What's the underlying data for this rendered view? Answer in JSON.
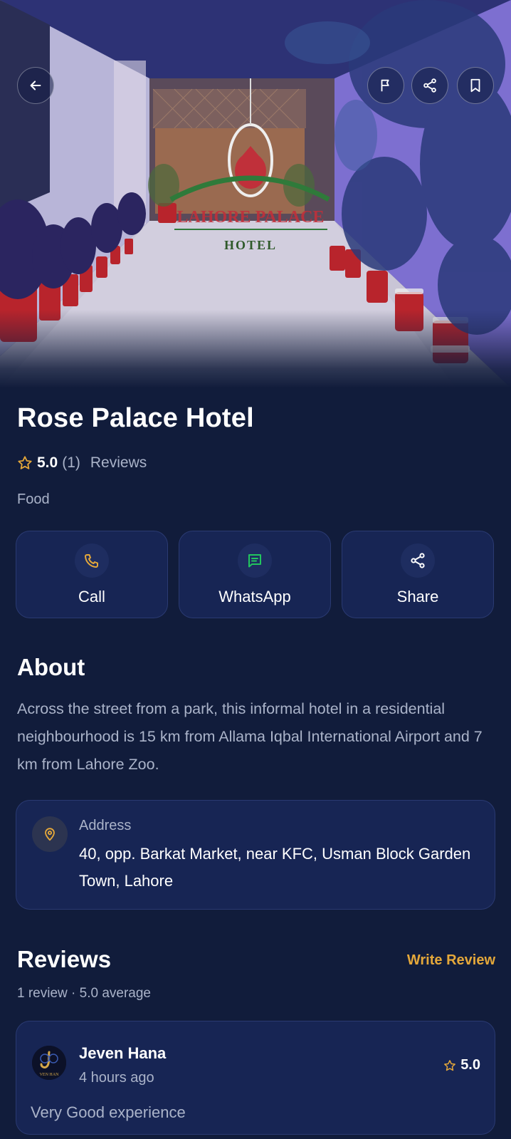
{
  "hero": {
    "sign_line1": "LAHORE PALACE",
    "sign_line2": "HOTEL"
  },
  "top_actions": {
    "back": "arrow-left-icon",
    "flag": "flag-icon",
    "share": "share-icon",
    "bookmark": "bookmark-icon"
  },
  "place": {
    "name": "Rose Palace Hotel",
    "rating": "5.0",
    "rating_count": "(1)",
    "reviews_label": "Reviews",
    "category": "Food"
  },
  "actions": [
    {
      "label": "Call",
      "icon": "phone-icon",
      "color": "#e5a83a"
    },
    {
      "label": "WhatsApp",
      "icon": "message-icon",
      "color": "#22c55e"
    },
    {
      "label": "Share",
      "icon": "share-icon",
      "color": "#ffffff"
    }
  ],
  "about": {
    "title": "About",
    "text": "Across the street from a park, this informal hotel in a residential neighbourhood is 15 km from Allama Iqbal International Airport and 7 km from Lahore Zoo."
  },
  "address": {
    "label": "Address",
    "value": "40, opp. Barkat Market, near KFC, Usman Block Garden Town, Lahore"
  },
  "reviews": {
    "title": "Reviews",
    "write_review": "Write Review",
    "summary": "1 review · 5.0 average",
    "items": [
      {
        "name": "Jeven Hana",
        "time": "4 hours ago",
        "rating": "5.0",
        "comment": "Very Good experience",
        "avatar_text": "VEN HAN"
      }
    ]
  },
  "colors": {
    "background": "#111c3b",
    "card": "#172554",
    "accent": "#e5a83a",
    "muted_text": "#aab3c9"
  }
}
